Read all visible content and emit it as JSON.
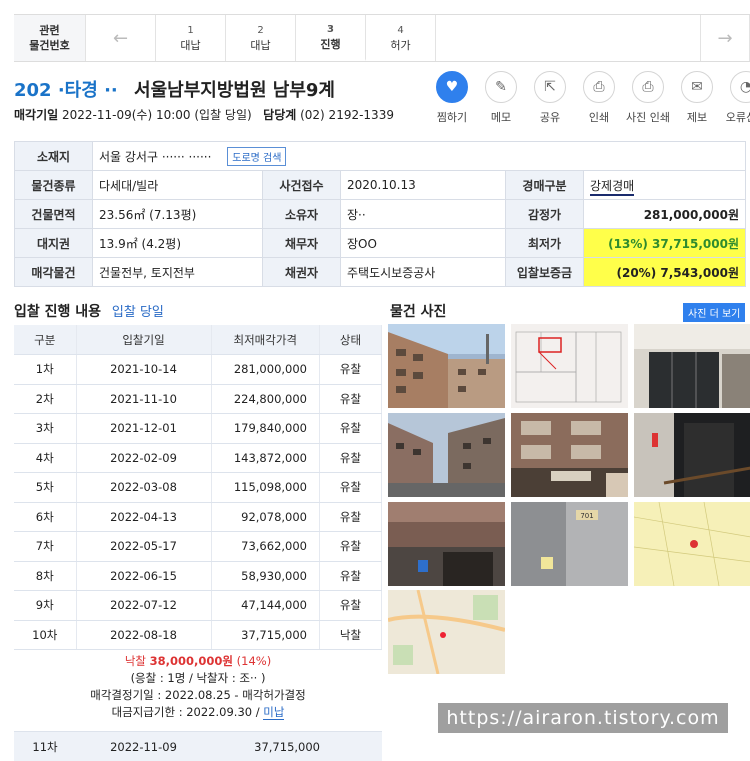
{
  "tabs": {
    "first": [
      "관련",
      "물건번호"
    ],
    "items": [
      {
        "num": "1",
        "label": "대납"
      },
      {
        "num": "2",
        "label": "대납"
      },
      {
        "num": "3",
        "label": "진행"
      },
      {
        "num": "4",
        "label": "허가"
      }
    ]
  },
  "header": {
    "case_no": "202 ·타경 ··",
    "court": "서울남부지방법원 남부9계",
    "sale_date_label": "매각기일",
    "sale_date": "2022-11-09(수) 10:00 (입찰 당일)",
    "dept_label": "담당계",
    "dept_phone": "(02) 2192-1339"
  },
  "actions": [
    {
      "name": "like",
      "label": "찜하기",
      "icon": "heart-icon"
    },
    {
      "name": "memo",
      "label": "메모",
      "icon": "pencil-icon"
    },
    {
      "name": "share",
      "label": "공유",
      "icon": "share-icon"
    },
    {
      "name": "print",
      "label": "인쇄",
      "icon": "printer-icon"
    },
    {
      "name": "photo-print",
      "label": "사진 인쇄",
      "icon": "printer-icon"
    },
    {
      "name": "report",
      "label": "제보",
      "icon": "mail-icon"
    },
    {
      "name": "error",
      "label": "오류신고",
      "icon": "ghost-icon"
    }
  ],
  "info": {
    "location_label": "소재지",
    "location": "서울 강서구 ······ ······",
    "road_btn": "도로명 검색",
    "type_label": "물건종류",
    "type": "다세대/빌라",
    "reception_label": "사건접수",
    "reception": "2020.10.13",
    "auction_kind_label": "경매구분",
    "auction_kind": "강제경매",
    "bldg_area_label": "건물면적",
    "bldg_area": "23.56㎡ (7.13평)",
    "owner_label": "소유자",
    "owner": "장··",
    "appraisal_label": "감정가",
    "appraisal": "281,000,000원",
    "land_label": "대지권",
    "land": "13.9㎡ (4.2평)",
    "debtor_label": "채무자",
    "debtor": "장OO",
    "min_price_label": "최저가",
    "min_price_pct": "(13%)",
    "min_price": "37,715,000원",
    "sale_item_label": "매각물건",
    "sale_item": "건물전부, 토지전부",
    "creditor_label": "채권자",
    "creditor": "주택도시보증공사",
    "deposit_label": "입찰보증금",
    "deposit_pct": "(20%)",
    "deposit": "7,543,000원"
  },
  "history": {
    "title": "입찰 진행 내용",
    "today": "입찰 당일",
    "headers": [
      "구분",
      "입찰기일",
      "최저매각가격",
      "상태"
    ],
    "rows": [
      [
        "1차",
        "2021-10-14",
        "281,000,000",
        "유찰"
      ],
      [
        "2차",
        "2021-11-10",
        "224,800,000",
        "유찰"
      ],
      [
        "3차",
        "2021-12-01",
        "179,840,000",
        "유찰"
      ],
      [
        "4차",
        "2022-02-09",
        "143,872,000",
        "유찰"
      ],
      [
        "5차",
        "2022-03-08",
        "115,098,000",
        "유찰"
      ],
      [
        "6차",
        "2022-04-13",
        "92,078,000",
        "유찰"
      ],
      [
        "7차",
        "2022-05-17",
        "73,662,000",
        "유찰"
      ],
      [
        "8차",
        "2022-06-15",
        "58,930,000",
        "유찰"
      ],
      [
        "9차",
        "2022-07-12",
        "47,144,000",
        "유찰"
      ],
      [
        "10차",
        "2022-08-18",
        "37,715,000",
        "낙찰"
      ]
    ],
    "result": {
      "won_prefix": "낙찰",
      "won_amount": "38,000,000원",
      "won_pct": "(14%)",
      "bidders": "(응찰 : 1명 / 낙찰자 : 조·· )",
      "decision": "매각결정기일 : 2022.08.25 - 매각허가결정",
      "payment_prefix": "대금지급기한 : 2022.09.30 /",
      "payment_status": "미납"
    },
    "last": [
      "11차",
      "2022-11-09",
      "37,715,000"
    ]
  },
  "photos": {
    "title": "물건 사진",
    "more_btn": "사진 더 보기",
    "door_no": "701"
  },
  "watermark": "https://airaron.tistory.com"
}
